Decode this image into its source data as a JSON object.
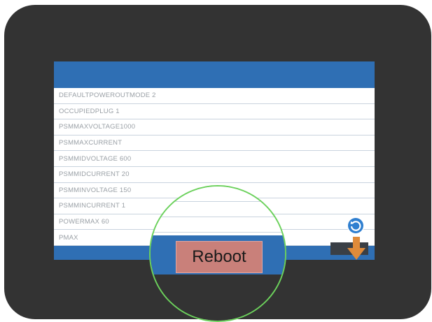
{
  "params": [
    {
      "label": "DEFAULTPOWEROUTMODE 2"
    },
    {
      "label": "OCCUPIEDPLUG 1"
    },
    {
      "label": "PSMMAXVOLTAGE1000"
    },
    {
      "label": "PSMMAXCURRENT"
    },
    {
      "label": "PSMMIDVOLTAGE 600"
    },
    {
      "label": "PSMMIDCURRENT 20"
    },
    {
      "label": "PSMMINVOLTAGE 150"
    },
    {
      "label": "PSMMINCURRENT 1"
    },
    {
      "label": "POWERMAX 60"
    },
    {
      "label": "PMAX"
    }
  ],
  "reboot_button": {
    "label": "Reboot"
  },
  "icons": {
    "refresh": "refresh-icon",
    "scroll_down": "arrow-down-icon"
  },
  "colors": {
    "bezel": "#333333",
    "header": "#2f6fb4",
    "reboot_button": "#c9807a",
    "highlight_circle": "#6cd15c",
    "arrow": "#e08b3a",
    "refresh": "#2f7fd0"
  }
}
